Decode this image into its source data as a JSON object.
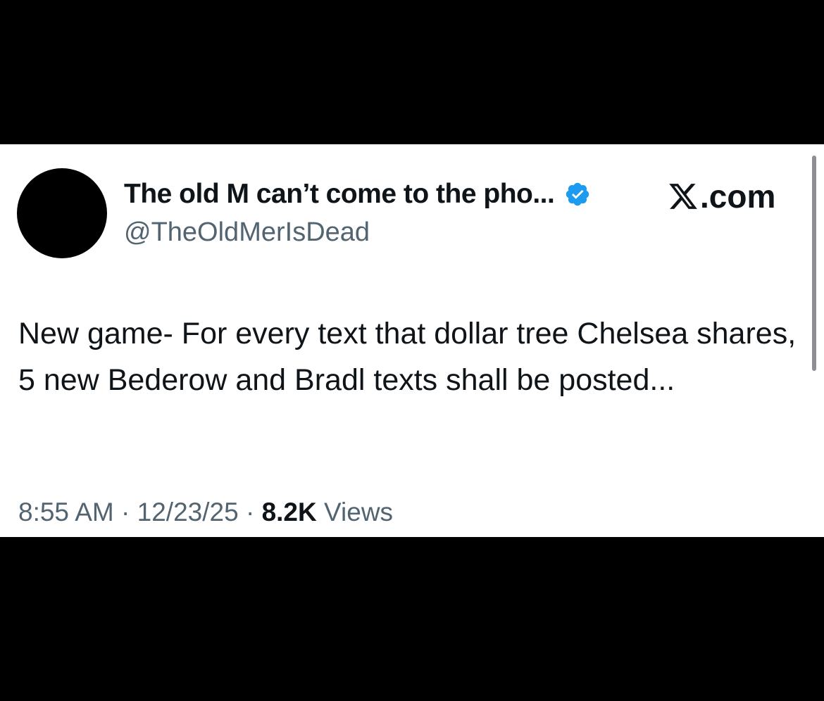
{
  "tweet": {
    "author": {
      "display_name": "The old M can’t come to the pho...",
      "handle": "@TheOldMerIsDead",
      "verified": true,
      "verified_icon": "verified-badge-icon",
      "verified_color": "#1d9bf0"
    },
    "brand": {
      "icon": "x-logo-icon",
      "text": ".com"
    },
    "text": "New game- For every text that dollar tree Chelsea shares, 5 new Bederow and Bradl texts shall be posted...",
    "meta": {
      "time": "8:55 AM",
      "separator": "·",
      "date": "12/23/25",
      "views_count": "8.2K",
      "views_label": "Views"
    }
  },
  "colors": {
    "background": "#000000",
    "card": "#ffffff",
    "primary_text": "#0f1419",
    "secondary_text": "#536471"
  }
}
